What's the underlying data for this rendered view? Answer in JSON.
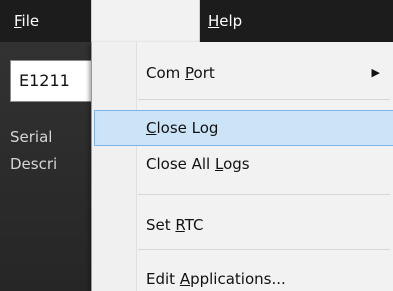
{
  "menubar": {
    "file": {
      "pre": "",
      "key": "F",
      "post": "ile"
    },
    "help": {
      "pre": "",
      "key": "H",
      "post": "elp"
    }
  },
  "background": {
    "id_field_value": "E1211",
    "serial_label": "Serial",
    "description_label": "Descri"
  },
  "dropdown": {
    "com_port": {
      "pre": "Com ",
      "key": "P",
      "post": "ort",
      "arrow": "▶"
    },
    "close_log": {
      "pre": "",
      "key": "C",
      "post": "lose Log"
    },
    "close_all_logs": {
      "pre": "Close All ",
      "key": "L",
      "post": "ogs"
    },
    "set_rtc": {
      "pre": "Set ",
      "key": "R",
      "post": "TC"
    },
    "edit_applications": {
      "pre": "Edit ",
      "key": "A",
      "post": "pplications..."
    }
  }
}
